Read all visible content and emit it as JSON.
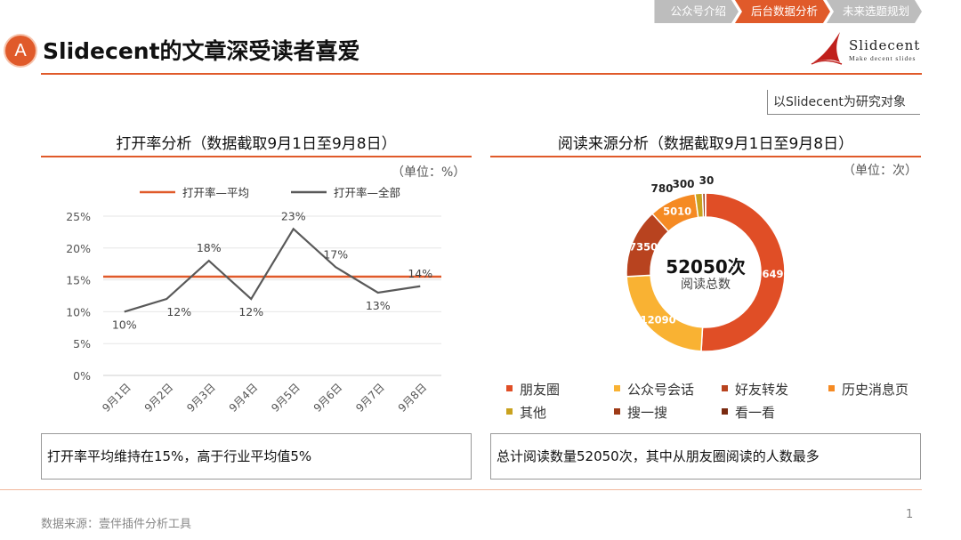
{
  "nav": {
    "tabs": [
      "公众号介绍",
      "后台数据分析",
      "未来选题规划"
    ],
    "active_index": 1,
    "active_color": "#e05a2a",
    "inactive_color": "#bdbdbd"
  },
  "header": {
    "badge": "A",
    "title": "Slidecent的文章深受读者喜爱",
    "logo_name": "Slidecent",
    "logo_tagline": "Make decent slides",
    "accent_color": "#e05a2a"
  },
  "note": "以Slidecent为研究对象",
  "left_panel": {
    "title": "打开率分析（数据截取9月1日至9月8日）",
    "unit": "（单位：%）",
    "summary": "打开率平均维持在15%，高于行业平均值5%"
  },
  "right_panel": {
    "title": "阅读来源分析（数据截取9月1日至9月8日）",
    "unit": "（单位：次）",
    "center_value": "52050次",
    "center_label": "阅读总数",
    "summary": "总计阅读数量52050次，其中从朋友圈阅读的人数最多"
  },
  "chart_data": [
    {
      "type": "line",
      "x": [
        "9月1日",
        "9月2日",
        "9月3日",
        "9月4日",
        "9月5日",
        "9月6日",
        "9月7日",
        "9月8日"
      ],
      "series": [
        {
          "name": "打开率—平均",
          "values": [
            15.5,
            15.5,
            15.5,
            15.5,
            15.5,
            15.5,
            15.5,
            15.5
          ],
          "color": "#e05a2a"
        },
        {
          "name": "打开率—全部",
          "values": [
            10,
            12,
            18,
            12,
            23,
            17,
            13,
            14
          ],
          "labels": [
            "10%",
            "12%",
            "18%",
            "12%",
            "23%",
            "17%",
            "13%",
            "14%"
          ],
          "color": "#595959"
        }
      ],
      "yticks": [
        "25%",
        "20%",
        "15%",
        "10%",
        "5%",
        "0%"
      ],
      "ylim": [
        0,
        25
      ],
      "grid": true,
      "legend": "top"
    },
    {
      "type": "pie",
      "donut": true,
      "slices": [
        {
          "name": "朋友圈",
          "value": 26490,
          "label": "26490",
          "color": "#e04e26"
        },
        {
          "name": "公众号会话",
          "value": 12090,
          "label": "12090",
          "color": "#f9b233"
        },
        {
          "name": "好友转发",
          "value": 7350,
          "label": "7350",
          "color": "#b8431f"
        },
        {
          "name": "历史消息页",
          "value": 5010,
          "label": "5010",
          "color": "#f58a23"
        },
        {
          "name": "其他",
          "value": 780,
          "label": "780",
          "color": "#c9a21e"
        },
        {
          "name": "搜一搜",
          "value": 300,
          "label": "300",
          "color": "#9e3a16"
        },
        {
          "name": "看一看",
          "value": 30,
          "label": "30",
          "color": "#7a2a10"
        }
      ],
      "legend": "bottom"
    }
  ],
  "footer": {
    "source": "数据来源：壹伴插件分析工具",
    "page": "1"
  }
}
